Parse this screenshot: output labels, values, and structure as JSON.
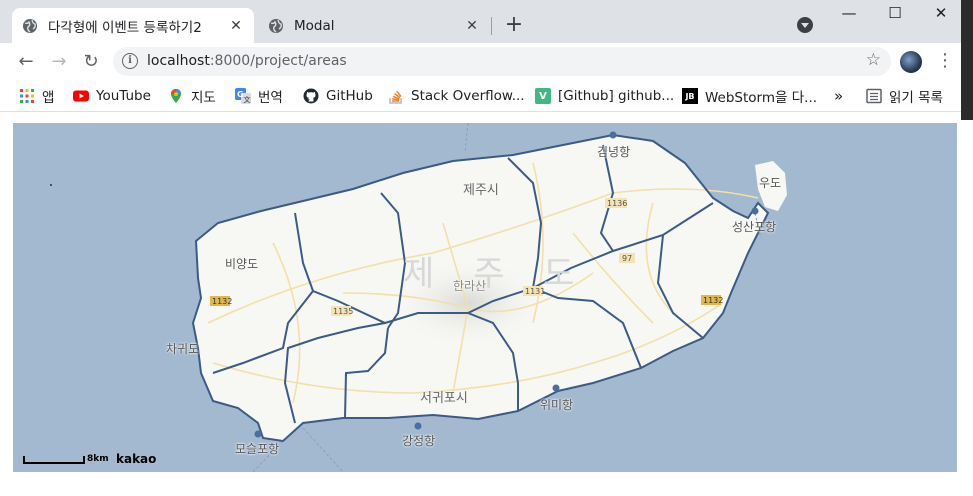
{
  "tabs": [
    {
      "title": "다각형에 이벤트 등록하기2",
      "close": "✕"
    },
    {
      "title": "Modal",
      "close": "✕"
    }
  ],
  "new_tab": "+",
  "window": {
    "minimize": "—",
    "maximize": "☐",
    "close": "✕"
  },
  "nav": {
    "back": "←",
    "forward": "→",
    "reload": "↻"
  },
  "omnibox": {
    "host": "localhost",
    "path": ":8000/project/areas",
    "info": "i",
    "star": "☆"
  },
  "menu_label": "⋮",
  "bookmarks": [
    {
      "label": "앱",
      "icon": "apps-grid-icon"
    },
    {
      "label": "YouTube",
      "icon": "youtube-icon",
      "color": "#ff0000"
    },
    {
      "label": "지도",
      "icon": "maps-pin-icon"
    },
    {
      "label": "번역",
      "icon": "translate-icon"
    },
    {
      "label": "GitHub",
      "icon": "github-icon"
    },
    {
      "label": "Stack Overflow...",
      "icon": "stackoverflow-icon",
      "color": "#f48024"
    },
    {
      "label": "[Github] github...",
      "icon": "vue-icon",
      "color": "#41b883",
      "glyph": "V"
    },
    {
      "label": "WebStorm을 다...",
      "icon": "jetbrains-icon",
      "glyph": "JB"
    },
    {
      "label": "»",
      "icon": "more-bookmarks-icon"
    },
    {
      "label": "읽기 목록",
      "icon": "reading-list-icon"
    }
  ],
  "map": {
    "colors": {
      "sea": "#a3b9d0",
      "land": "#f7f7f4",
      "border": "#3b5a85",
      "road": "#f3dfa8"
    },
    "place_labels": [
      "김녕항",
      "우도",
      "성산포항",
      "제주시",
      "비양도",
      "한라산",
      "차귀도",
      "서귀포시",
      "위미항",
      "강정항",
      "모슬포항"
    ],
    "road_numbers": [
      "1136",
      "97",
      "1132",
      "1135",
      "1132",
      "1131"
    ],
    "watermark": "제 주 도",
    "scale_label": "8km",
    "attribution": "kakao"
  }
}
